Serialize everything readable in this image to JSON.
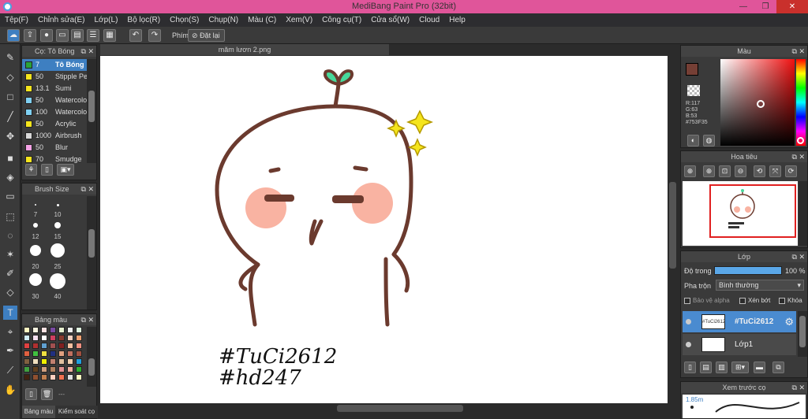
{
  "window": {
    "title": "MediBang Paint Pro (32bit)",
    "minimize": "—",
    "maximize": "❐",
    "close": "✕"
  },
  "menu": [
    "Tệp(F)",
    "Chỉnh sửa(E)",
    "Lớp(L)",
    "Bộ lọc(R)",
    "Chọn(S)",
    "Chụp(N)",
    "Màu (C)",
    "Xem(V)",
    "Công cụ(T)",
    "Cửa sổ(W)",
    "Cloud",
    "Help"
  ],
  "toolbar": {
    "phim_label": "Phím",
    "reset_label": "Đặt lại"
  },
  "brush_panel": {
    "title": "Cọ: Tô Bóng",
    "items": [
      {
        "size": "7",
        "name": "Tô Bóng",
        "color": "#2aa33b"
      },
      {
        "size": "50",
        "name": "Stipple Pen",
        "color": "#f5e51c"
      },
      {
        "size": "13.1",
        "name": "Sumi",
        "color": "#f5e51c"
      },
      {
        "size": "50",
        "name": "Watercolor",
        "color": "#7fd0f2"
      },
      {
        "size": "100",
        "name": "Watercolor",
        "color": "#7fd0f2"
      },
      {
        "size": "50",
        "name": "Acrylic",
        "color": "#f5e51c"
      },
      {
        "size": "1000",
        "name": "Airbrush",
        "color": "#d8d8d8"
      },
      {
        "size": "50",
        "name": "Blur",
        "color": "#f4a3e6"
      },
      {
        "size": "70",
        "name": "Smudge",
        "color": "#f5e51c"
      }
    ]
  },
  "brush_size_panel": {
    "title": "Brush Size",
    "sizes": [
      "7",
      "10",
      "12",
      "15",
      "20",
      "25",
      "30",
      "40"
    ]
  },
  "palette_panel": {
    "title": "Bảng màu",
    "tab_palette": "Bảng màu",
    "tab_control": "Kiểm soát cọ",
    "dash": "---"
  },
  "document": {
    "tab": "măm lươn 2.png",
    "text_line1": "#TuCi2612",
    "text_line2": "#hd247"
  },
  "color_panel": {
    "title": "Màu",
    "r": "R:117",
    "g": "G:63",
    "b": "B:53",
    "hex": "#753F35",
    "main_color": "#753f35"
  },
  "navigator_panel": {
    "title": "Hoa tiêu"
  },
  "layer_panel": {
    "title": "Lớp",
    "opacity_label": "Độ trong",
    "opacity_value": "100 %",
    "blend_label": "Pha trộn",
    "blend_value": "Bình thường",
    "alpha_lock": "Bảo vệ alpha",
    "clip": "Xén bớt",
    "lock": "Khóa",
    "layers": [
      {
        "name": "#TuCi2612",
        "thumb": "#TuCi2612"
      },
      {
        "name": "Lớp1",
        "thumb": ""
      }
    ]
  },
  "preview_panel": {
    "title": "Xem trước cọ",
    "size": "1.85m"
  }
}
